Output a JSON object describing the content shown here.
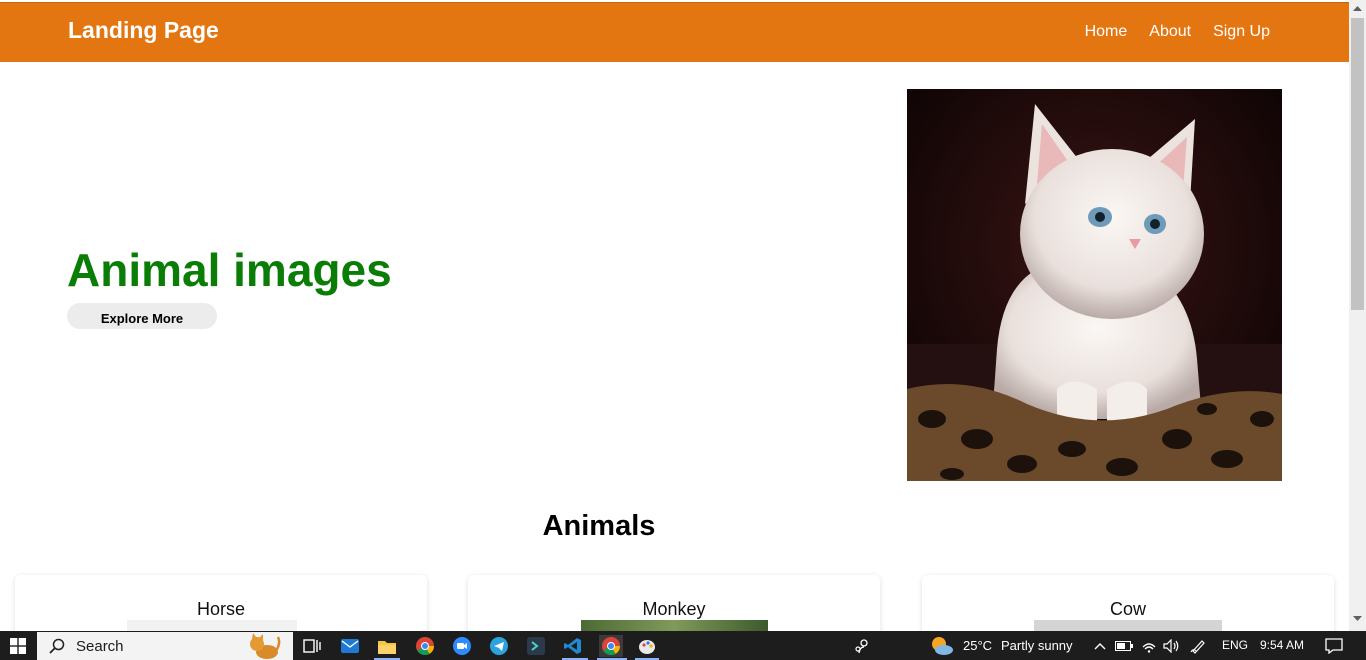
{
  "navbar": {
    "brand": "Landing Page",
    "links": [
      "Home",
      "About",
      "Sign Up"
    ]
  },
  "hero": {
    "title": "Animal images",
    "button": "Explore More",
    "image_alt": "white kitten photo"
  },
  "section": {
    "title": "Animals"
  },
  "cards": [
    {
      "title": "Horse"
    },
    {
      "title": "Monkey"
    },
    {
      "title": "Cow"
    }
  ],
  "taskbar": {
    "search_placeholder": "Search",
    "weather": "25°C",
    "weather_desc": "Partly sunny",
    "language": "ENG",
    "time": "9:54 AM"
  },
  "colors": {
    "navbar": "#e37611",
    "hero_title": "#0a7d06",
    "taskbar": "#1d1d1d"
  }
}
